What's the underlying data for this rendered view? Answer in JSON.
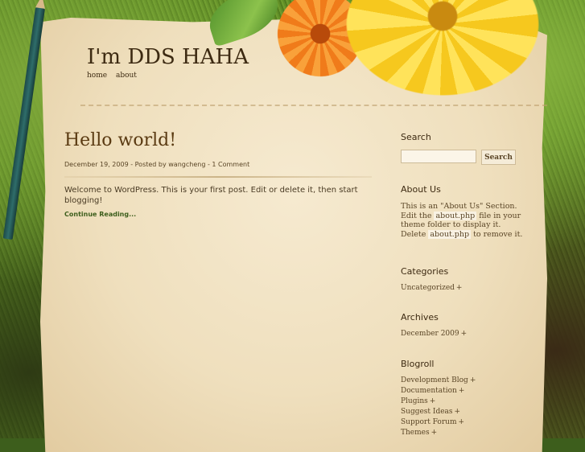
{
  "site": {
    "title": "I'm DDS HAHA"
  },
  "nav": {
    "items": [
      {
        "label": "home"
      },
      {
        "label": "about"
      }
    ]
  },
  "post": {
    "title": "Hello world!",
    "date": "December 19, 2009",
    "posted_by_prefix": " - Posted by ",
    "author": "wangcheng",
    "separator": " - ",
    "comments": "1 Comment",
    "body": "Welcome to WordPress. This is your first post. Edit or delete it, then start blogging!",
    "continue_label": "Continue Reading..."
  },
  "sidebar": {
    "search": {
      "title": "Search",
      "placeholder": "",
      "button_label": "Search"
    },
    "about": {
      "title": "About Us",
      "text_1": "This is an \"About Us\" Section. Edit the ",
      "code_1": "about.php",
      "text_2": " file in your theme folder to display it. Delete ",
      "code_2": "about.php",
      "text_3": " to remove it."
    },
    "categories": {
      "title": "Categories",
      "items": [
        {
          "label": "Uncategorized"
        }
      ]
    },
    "archives": {
      "title": "Archives",
      "items": [
        {
          "label": "December 2009"
        }
      ]
    },
    "blogroll": {
      "title": "Blogroll",
      "items": [
        {
          "label": "Development Blog"
        },
        {
          "label": "Documentation"
        },
        {
          "label": "Plugins"
        },
        {
          "label": "Suggest Ideas"
        },
        {
          "label": "Support Forum"
        },
        {
          "label": "Themes"
        }
      ]
    },
    "plus_symbol": "+"
  }
}
